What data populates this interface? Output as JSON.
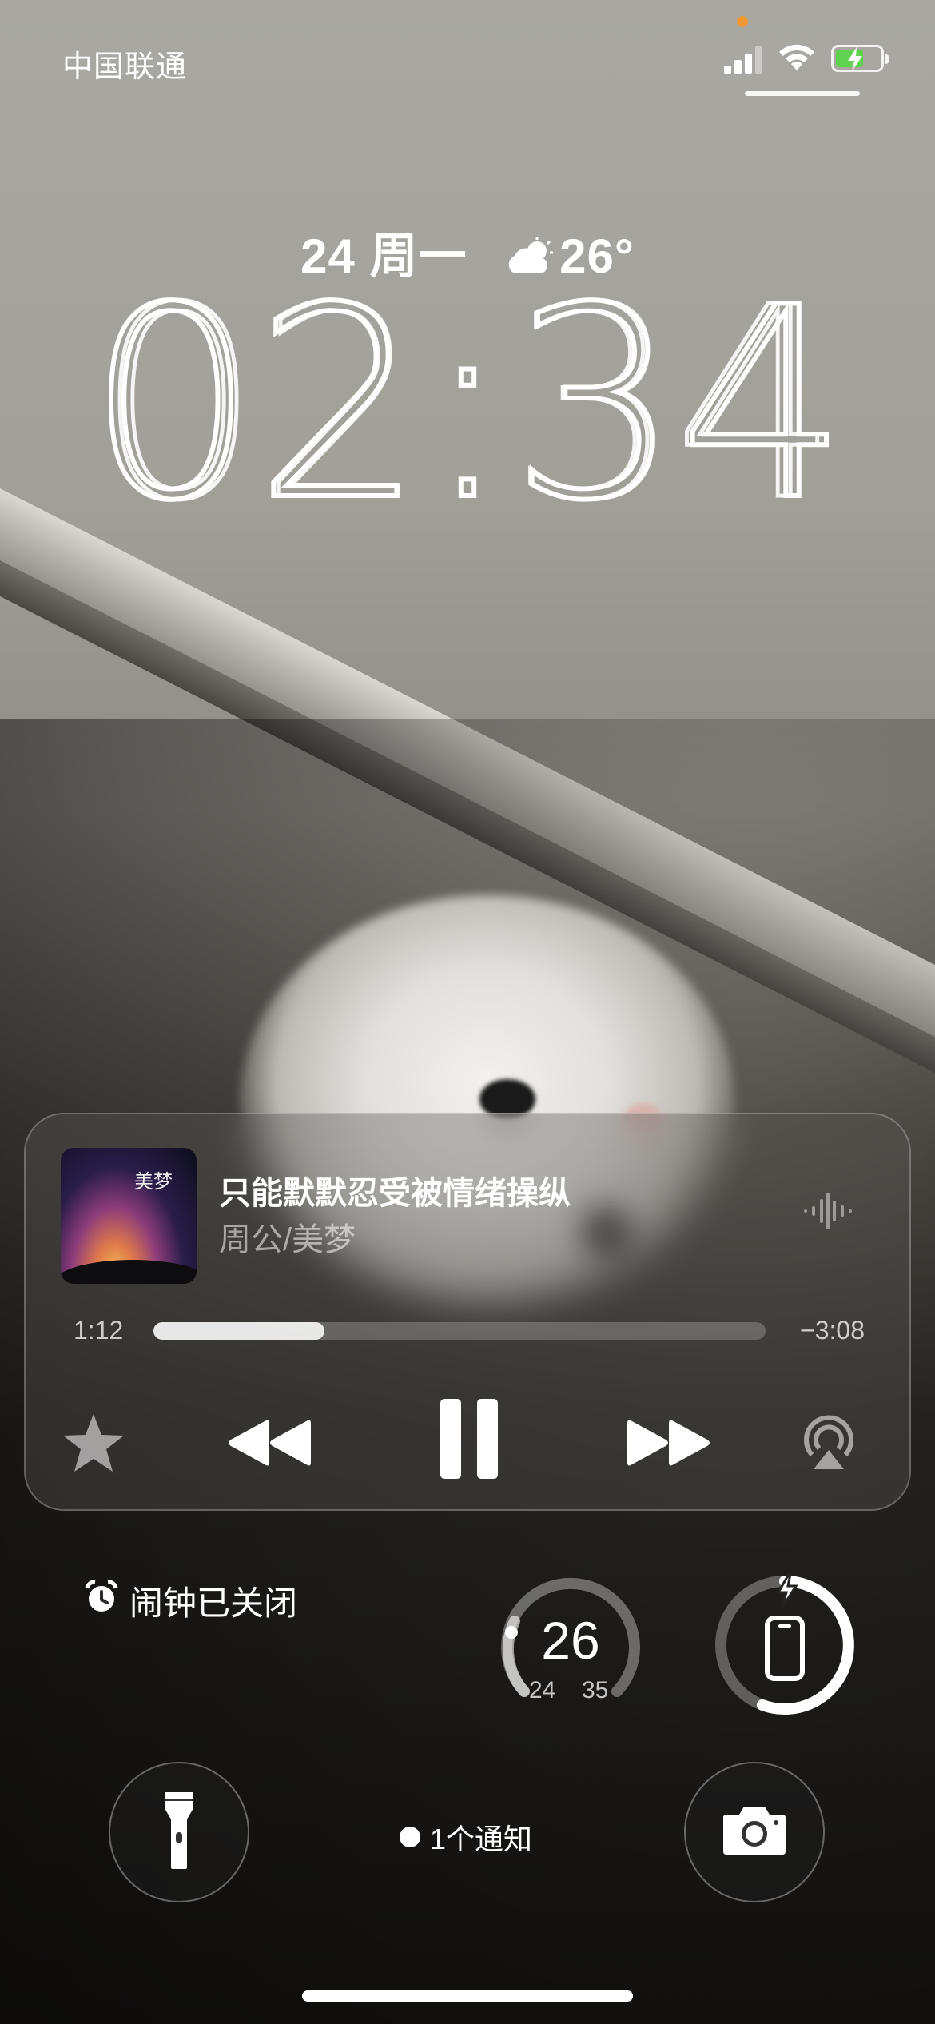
{
  "status_bar": {
    "carrier": "中国联通",
    "icons": [
      "signal-icon",
      "wifi-icon",
      "battery-charging-icon"
    ],
    "privacy_indicator_color": "#f09a35"
  },
  "lock_screen": {
    "date": "24 周一",
    "weather_icon": "partly-cloudy-icon",
    "weather_temp": "26°",
    "time": "02:34"
  },
  "now_playing": {
    "album_art_text": "美梦",
    "title": "只能默默忍受被情绪操纵",
    "artist": "周公/美梦",
    "elapsed": "1:12",
    "remaining": "−3:08",
    "progress_fraction": 0.28,
    "controls": [
      "star-icon",
      "rewind-icon",
      "pause-icon",
      "forward-icon",
      "airplay-icon"
    ]
  },
  "widgets": {
    "alarm_text": "闹钟已关闭",
    "temperature": {
      "current": "26",
      "low": "24",
      "high": "35"
    },
    "battery_icon": "phone-charging-icon"
  },
  "bottom": {
    "notification_text": "1个通知",
    "left_button_icon": "flashlight-icon",
    "right_button_icon": "camera-icon"
  },
  "colors": {
    "battery_green": "#5fd24f"
  }
}
